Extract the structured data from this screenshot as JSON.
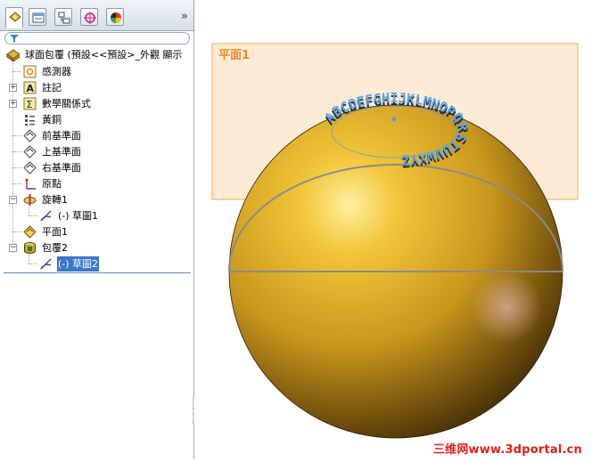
{
  "tabs": [
    {
      "icon": "feature-manager-icon",
      "active": true
    },
    {
      "icon": "property-manager-icon",
      "active": false
    },
    {
      "icon": "configuration-manager-icon",
      "active": false
    },
    {
      "icon": "dimxpert-icon",
      "active": false
    },
    {
      "icon": "display-manager-icon",
      "active": false
    }
  ],
  "more_tabs": "»",
  "tree": {
    "root": "球面包覆 (預設<<預設>_外觀 顯示",
    "items": [
      {
        "label": "感測器",
        "icon": "sensor-icon"
      },
      {
        "label": "註記",
        "icon": "annotation-icon"
      },
      {
        "label": "數學關係式",
        "icon": "equation-icon"
      },
      {
        "label": "黃銅",
        "icon": "material-icon"
      },
      {
        "label": "前基準面",
        "icon": "plane-icon"
      },
      {
        "label": "上基準面",
        "icon": "plane-icon"
      },
      {
        "label": "右基準面",
        "icon": "plane-icon"
      },
      {
        "label": "原點",
        "icon": "origin-icon"
      },
      {
        "label": "旋轉1",
        "icon": "revolve-icon"
      },
      {
        "label": "(-) 草圖1",
        "icon": "sketch-icon"
      },
      {
        "label": "平面1",
        "icon": "plane-icon"
      },
      {
        "label": "包覆2",
        "icon": "wrap-icon"
      },
      {
        "label": "(-) 草圖2",
        "icon": "sketch-icon",
        "selected": true
      }
    ]
  },
  "viewport": {
    "plane_label": "平面1",
    "wrap_text": "ABCDEFGHIJKLMNOPQRSTUVWXYZ",
    "plane_color": "#f0a040",
    "sphere_color": "#d8a820",
    "sketch_color": "#4f9be0"
  },
  "watermark": "三维网www.3dportal.cn"
}
